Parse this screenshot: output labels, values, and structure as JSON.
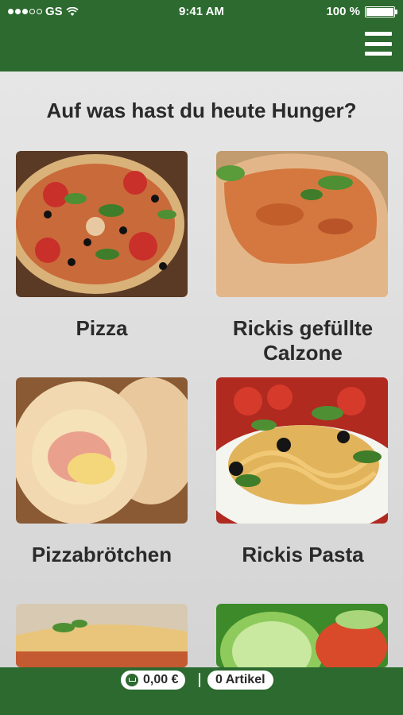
{
  "status_bar": {
    "carrier": "GS",
    "time": "9:41 AM",
    "battery": "100 %"
  },
  "header": {
    "menu_icon": "hamburger-menu-icon"
  },
  "main": {
    "headline": "Auf was hast du heute Hunger?",
    "categories": [
      {
        "label": "Pizza",
        "image": "pizza-photo"
      },
      {
        "label": "Rickis gefüllte Calzone",
        "image": "calzone-photo"
      },
      {
        "label": "Pizzabrötchen",
        "image": "pizza-rolls-photo"
      },
      {
        "label": "Rickis Pasta",
        "image": "pasta-photo"
      },
      {
        "label": "",
        "image": "lasagna-photo"
      },
      {
        "label": "",
        "image": "salad-photo"
      }
    ]
  },
  "footer": {
    "cart_total": "0,00 €",
    "cart_items": "0 Artikel"
  }
}
